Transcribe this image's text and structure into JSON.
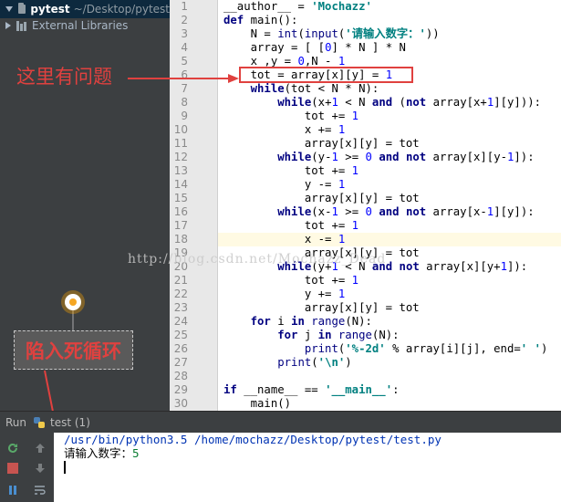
{
  "project_panel": {
    "root_name": "pytest",
    "root_path": "~/Desktop/pytest",
    "libraries": "External Libraries"
  },
  "annotations": {
    "problem_label": "这里有问题",
    "loop_label": "陷入死循环",
    "watermark": "http://blog.csdn.net/Mochazz_Dead",
    "color": "#e0413f"
  },
  "editor": {
    "highlighted_line": 18,
    "lines": [
      {
        "n": "1",
        "html": "<span>__author__ = </span><span class='str'>'Mochazz'</span>"
      },
      {
        "n": "2",
        "html": "<span class='kw'>def</span> main():"
      },
      {
        "n": "3",
        "html": "    N = <span class='builtin'>int</span>(<span class='builtin'>input</span>(<span class='str'>'请输入数字：'</span>))"
      },
      {
        "n": "4",
        "html": "    array = [ [<span class='num'>0</span>] * N ] * N"
      },
      {
        "n": "5",
        "html": "    x ,y = <span class='num'>0</span>,N - <span class='num'>1</span>"
      },
      {
        "n": "6",
        "html": "    tot = array[x][y] = <span class='num'>1</span>"
      },
      {
        "n": "7",
        "html": "    <span class='kw'>while</span>(tot &lt; N * N):"
      },
      {
        "n": "8",
        "html": "        <span class='kw'>while</span>(x+<span class='num'>1</span> &lt; N <span class='kw'>and</span> (<span class='kw'>not</span> array[x+<span class='num'>1</span>][y])):"
      },
      {
        "n": "9",
        "html": "            tot += <span class='num'>1</span>"
      },
      {
        "n": "10",
        "html": "            x += <span class='num'>1</span>"
      },
      {
        "n": "11",
        "html": "            array[x][y] = tot"
      },
      {
        "n": "12",
        "html": "        <span class='kw'>while</span>(y-<span class='num'>1</span> &gt;= <span class='num'>0</span> <span class='kw'>and not</span> array[x][y-<span class='num'>1</span>]):"
      },
      {
        "n": "13",
        "html": "            tot += <span class='num'>1</span>"
      },
      {
        "n": "14",
        "html": "            y -= <span class='num'>1</span>"
      },
      {
        "n": "15",
        "html": "            array[x][y] = tot"
      },
      {
        "n": "16",
        "html": "        <span class='kw'>while</span>(x-<span class='num'>1</span> &gt;= <span class='num'>0</span> <span class='kw'>and not</span> array[x-<span class='num'>1</span>][y]):"
      },
      {
        "n": "17",
        "html": "            tot += <span class='num'>1</span>"
      },
      {
        "n": "18",
        "html": "            x -= <span class='num'>1</span>"
      },
      {
        "n": "19",
        "html": "            array[x][y] = tot"
      },
      {
        "n": "20",
        "html": "        <span class='kw'>while</span>(y+<span class='num'>1</span> &lt; N <span class='kw'>and not</span> array[x][y+<span class='num'>1</span>]):"
      },
      {
        "n": "21",
        "html": "            tot += <span class='num'>1</span>"
      },
      {
        "n": "22",
        "html": "            y += <span class='num'>1</span>"
      },
      {
        "n": "23",
        "html": "            array[x][y] = tot"
      },
      {
        "n": "24",
        "html": "    <span class='kw'>for</span> i <span class='kw'>in</span> <span class='builtin'>range</span>(N):"
      },
      {
        "n": "25",
        "html": "        <span class='kw'>for</span> j <span class='kw'>in</span> <span class='builtin'>range</span>(N):"
      },
      {
        "n": "26",
        "html": "            <span class='builtin'>print</span>(<span class='str'>'%-2d'</span> % array[i][j], end=<span class='str'>' '</span>)"
      },
      {
        "n": "27",
        "html": "        <span class='builtin'>print</span>(<span class='str'>'\\n'</span>)"
      },
      {
        "n": "28",
        "html": ""
      },
      {
        "n": "29",
        "html": "<span class='kw'>if</span> __name__ == <span class='str'>'__main__'</span>:"
      },
      {
        "n": "30",
        "html": "    main()"
      }
    ]
  },
  "run_panel": {
    "tab_label": "Run",
    "config_name": "test (1)",
    "command": "/usr/bin/python3.5 /home/mochazz/Desktop/pytest/test.py",
    "prompt": "请输入数字：",
    "input_value": "5"
  }
}
